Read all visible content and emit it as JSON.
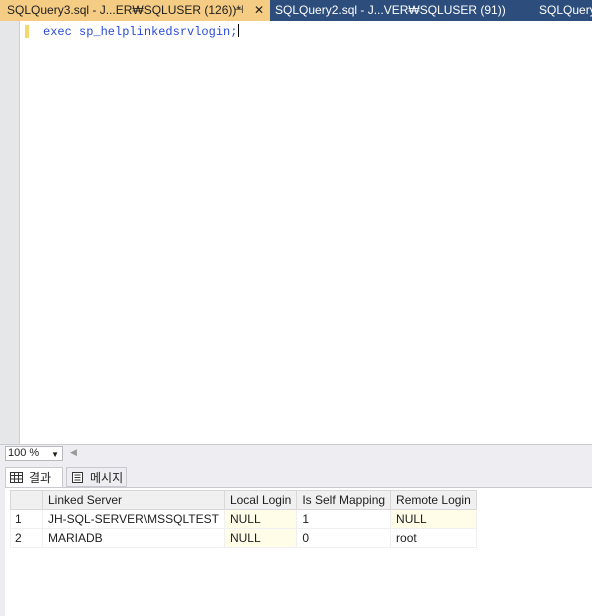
{
  "tabs": [
    {
      "label": "SQLQuery3.sql - J...ER₩SQLUSER (126))*",
      "active": true,
      "pin": "⊣",
      "close": "✕"
    },
    {
      "label": "SQLQuery2.sql - J...VER₩SQLUSER (91))"
    },
    {
      "label": "SQLQuery"
    }
  ],
  "editor": {
    "code": "exec sp_helplinkedsrvlogin;"
  },
  "zoom": {
    "value": "100 %"
  },
  "result_tabs": {
    "results_label": "결과",
    "messages_label": "메시지"
  },
  "grid": {
    "columns": [
      "Linked Server",
      "Local Login",
      "Is Self Mapping",
      "Remote Login"
    ],
    "rows": [
      {
        "num": "1",
        "linked_server": "JH-SQL-SERVER\\MSSQLTEST",
        "local_login": "NULL",
        "is_self_mapping": "1",
        "remote_login": "NULL"
      },
      {
        "num": "2",
        "linked_server": "MARIADB",
        "local_login": "NULL",
        "is_self_mapping": "0",
        "remote_login": "root"
      }
    ]
  },
  "colors": {
    "tab_active": "#f5cc84",
    "tab_bar": "#2d4e7c",
    "keyword": "#2a4bd7",
    "null_cell": "#fffde7"
  }
}
